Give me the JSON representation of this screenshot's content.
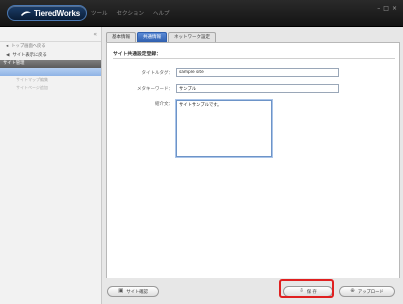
{
  "app": {
    "logo_text": "TieredWorks",
    "menu": [
      "ツール",
      "セクション",
      "ヘルプ"
    ],
    "window_controls": [
      "–",
      "□",
      "×"
    ]
  },
  "sidebar": {
    "collapse": "«",
    "items": [
      {
        "label": "トップ画面へ戻る",
        "style": "muted"
      },
      {
        "label": "サイト表示に戻る",
        "style": "strong"
      }
    ],
    "section_label": "サイト管理",
    "sub_items": [
      "",
      "サイトマップ編集",
      "サイトページ追加"
    ]
  },
  "tabs": [
    {
      "label": "基本情報",
      "active": false
    },
    {
      "label": "共通情報",
      "active": true
    },
    {
      "label": "ネットワーク設定",
      "active": false
    }
  ],
  "form": {
    "section_title": "サイト共通設定登録：",
    "title_tag": {
      "label": "タイトルタグ：",
      "value": "sample site"
    },
    "meta_keywords": {
      "label": "メタキーワード：",
      "value": "サンプル"
    },
    "description": {
      "label": "紹介文：",
      "value": "サイトサンプルです。"
    }
  },
  "footer": {
    "site_confirm": "サイト確認",
    "save": "保 存",
    "upload": "アップロード"
  },
  "colors": {
    "accent": "#2f5fae",
    "highlight": "#e02020"
  }
}
